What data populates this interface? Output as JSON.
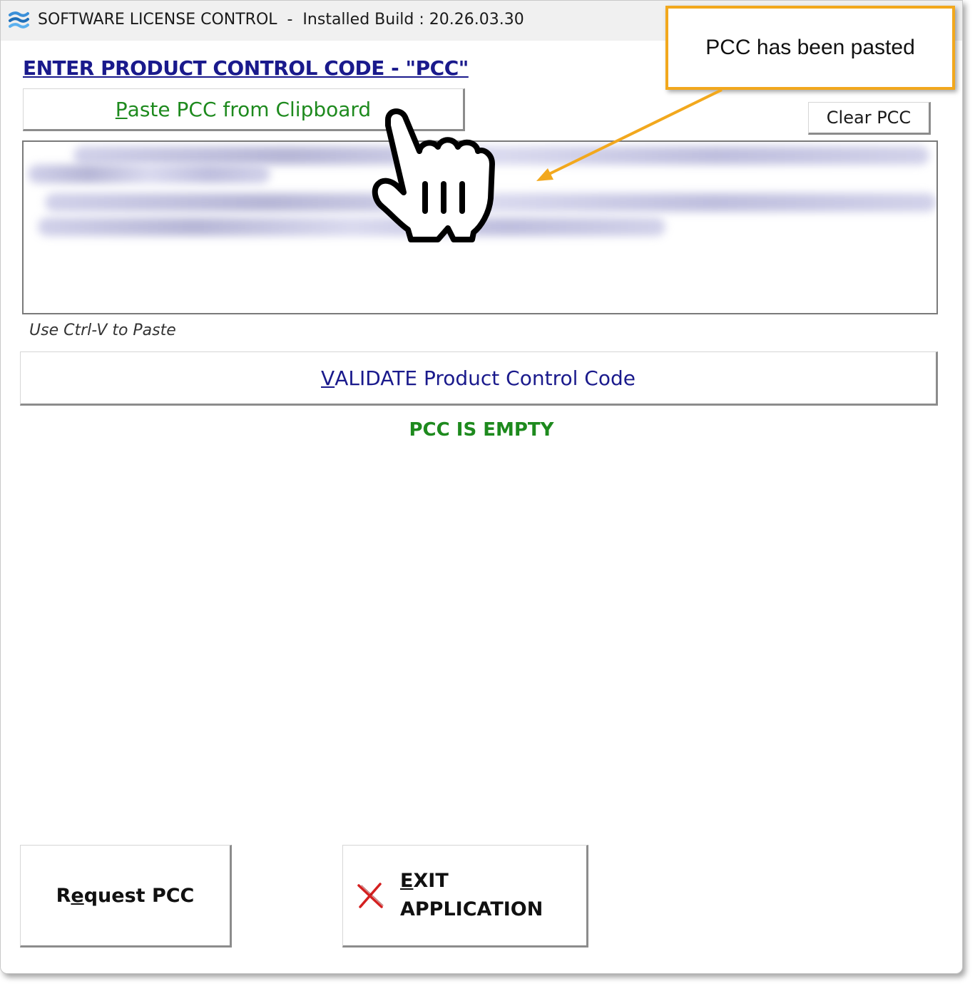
{
  "window": {
    "title": "SOFTWARE LICENSE CONTROL  -  Installed Build : 20.26.03.30"
  },
  "main": {
    "heading": "ENTER PRODUCT CONTROL CODE - \"PCC\"",
    "paste_button": {
      "mnemonic": "P",
      "rest": "aste PCC from Clipboard"
    },
    "clear_button": "Clear PCC",
    "pcc_text_hint": "Use Ctrl-V to Paste",
    "validate_button": {
      "mnemonic": "V",
      "rest": "ALIDATE Product Control Code"
    },
    "status": "PCC IS EMPTY"
  },
  "footer": {
    "request_button": {
      "pre": "R",
      "mnemonic": "e",
      "rest": "quest PCC"
    },
    "exit_button": {
      "mnemonic": "E",
      "line1_rest": "XIT",
      "line2": "APPLICATION"
    }
  },
  "annotation": {
    "callout_text": "PCC has been pasted",
    "color": "#f2a81d"
  },
  "icons": [
    "app-logo-icon",
    "exit-x-icon",
    "hand-pointer-cursor-icon"
  ],
  "colors": {
    "heading": "#1a1a8c",
    "paste_text": "#1e8a1e",
    "status_text": "#1e8a1e",
    "validate_text": "#1a1a8c"
  }
}
